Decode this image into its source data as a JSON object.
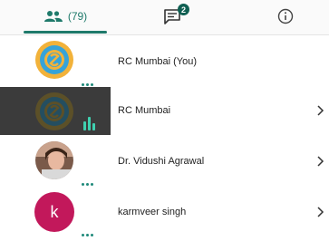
{
  "tabs": {
    "people_label": "(79)",
    "chat_badge": "2"
  },
  "participants": [
    {
      "name": "RC Mumbai (You)",
      "avatar": "logo-icon"
    },
    {
      "name": "RC Mumbai",
      "avatar": "logo-icon",
      "speaking": true
    },
    {
      "name": "Dr. Vidushi Agrawal",
      "avatar": "photo"
    },
    {
      "name": "karmveer singh",
      "avatar": "initial",
      "initial": "k",
      "avatar_color": "#c2185b"
    }
  ],
  "colors": {
    "accent": "#1f7a6b",
    "speaking_bar": "#3fd0b0",
    "highlight_row": "#3b3b3b"
  }
}
